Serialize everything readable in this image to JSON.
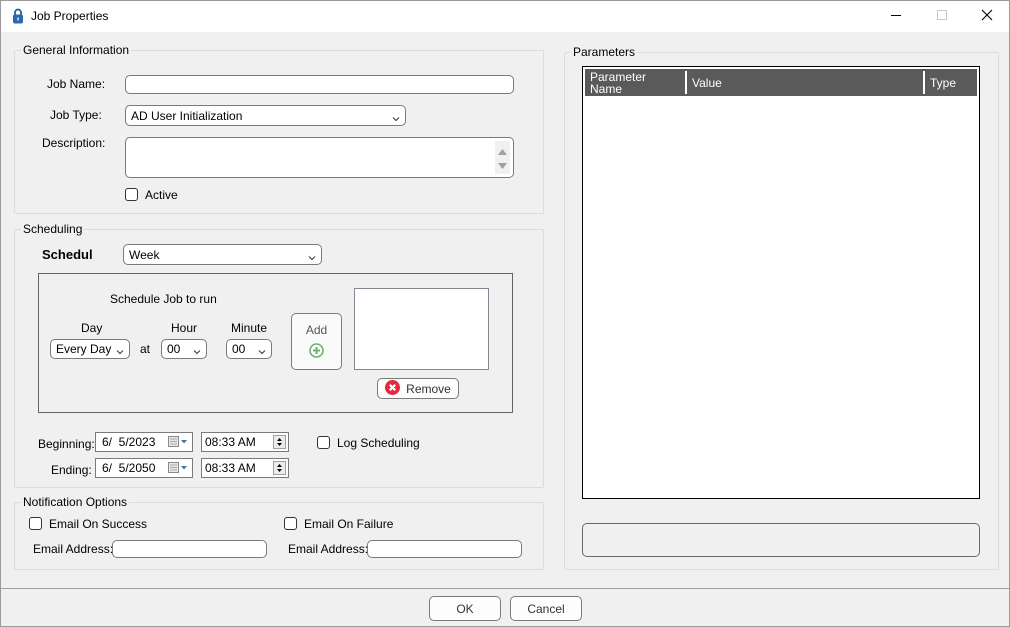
{
  "window": {
    "title": "Job Properties",
    "icon": "padlock-icon",
    "controls": {
      "minimize": "minimize-icon",
      "maximize": "maximize-icon",
      "close": "close-icon"
    }
  },
  "general": {
    "legend": "General Information",
    "job_name_label": "Job Name:",
    "job_name_value": "",
    "job_type_label": "Job Type:",
    "job_type_value": "AD User Initialization",
    "description_label": "Description:",
    "description_value": "",
    "active_label": "Active",
    "active_checked": false
  },
  "scheduling": {
    "legend": "Scheduling",
    "schedule_label": "Schedule",
    "schedule_value": "Week",
    "run_heading": "Schedule Job to run",
    "day_label": "Day",
    "day_value": "Every Day",
    "at_label": "at",
    "hour_label": "Hour",
    "hour_value": "00",
    "minute_label": "Minute",
    "minute_value": "00",
    "add_label": "Add",
    "remove_label": "Remove",
    "schedule_list": [],
    "beginning_label": "Beginning:",
    "beginning_date": "6/  5/2023",
    "beginning_time": "08:33 AM",
    "ending_label": "Ending:",
    "ending_date": "6/  5/2050",
    "ending_time": "08:33 AM",
    "log_scheduling_label": "Log Scheduling",
    "log_scheduling_checked": false
  },
  "notification": {
    "legend": "Notification Options",
    "success_label": "Email On Success",
    "success_checked": false,
    "success_email_label": "Email Address:",
    "success_email_value": "",
    "failure_label": "Email On Failure",
    "failure_checked": false,
    "failure_email_label": "Email Address:",
    "failure_email_value": ""
  },
  "parameters": {
    "legend": "Parameters",
    "columns": [
      "Parameter Name",
      "Value",
      "Type"
    ],
    "rows": [],
    "description_box": ""
  },
  "footer": {
    "ok_label": "OK",
    "cancel_label": "Cancel"
  },
  "colors": {
    "grid_header_bg": "#5a5a5a",
    "add_icon": "#6db36d",
    "remove_icon": "#e8283c"
  }
}
